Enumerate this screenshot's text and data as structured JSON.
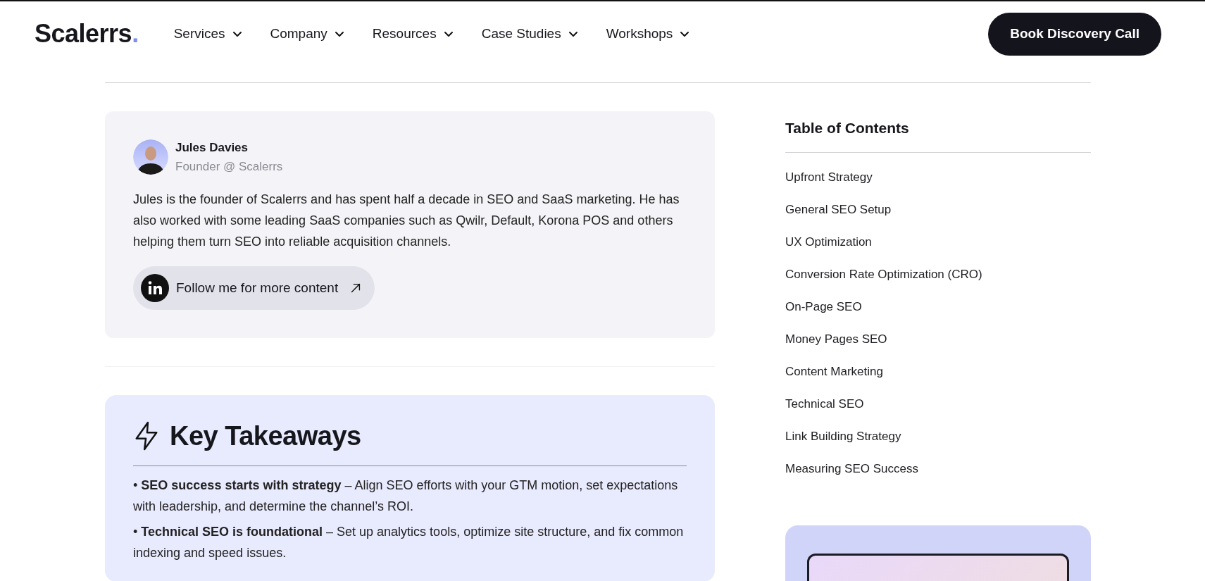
{
  "header": {
    "logo": {
      "text": "Scalerrs",
      "dot": "."
    },
    "nav": [
      {
        "label": "Services",
        "has_dropdown": true
      },
      {
        "label": "Company",
        "has_dropdown": true
      },
      {
        "label": "Resources",
        "has_dropdown": true
      },
      {
        "label": "Case Studies",
        "has_dropdown": true
      },
      {
        "label": "Workshops",
        "has_dropdown": true
      }
    ],
    "cta": "Book Discovery Call"
  },
  "author": {
    "name": "Jules Davies",
    "role": "Founder @ Scalerrs",
    "bio": "Jules is the founder of Scalerrs and has spent half a decade in SEO and SaaS marketing. He has also worked with some leading SaaS companies such as Qwilr, Default, Korona POS and others helping them turn SEO into reliable acquisition channels.",
    "follow_button": "Follow me for more content"
  },
  "key_takeaways": {
    "title": "Key Takeaways",
    "items": [
      "• **SEO success starts with strategy** – Align SEO efforts with your GTM motion, set expectations with leadership, and determine the channel’s ROI.",
      "• **Technical SEO is foundational** – Set up analytics tools, optimize site structure, and fix common indexing and speed issues."
    ]
  },
  "toc": {
    "title": "Table of Contents",
    "items": [
      "Upfront Strategy",
      "General SEO Setup",
      "UX Optimization",
      "Conversion Rate Optimization (CRO)",
      "On-Page SEO",
      "Money Pages SEO",
      "Content Marketing",
      "Technical SEO",
      "Link Building Strategy",
      "Measuring SEO Success"
    ]
  }
}
